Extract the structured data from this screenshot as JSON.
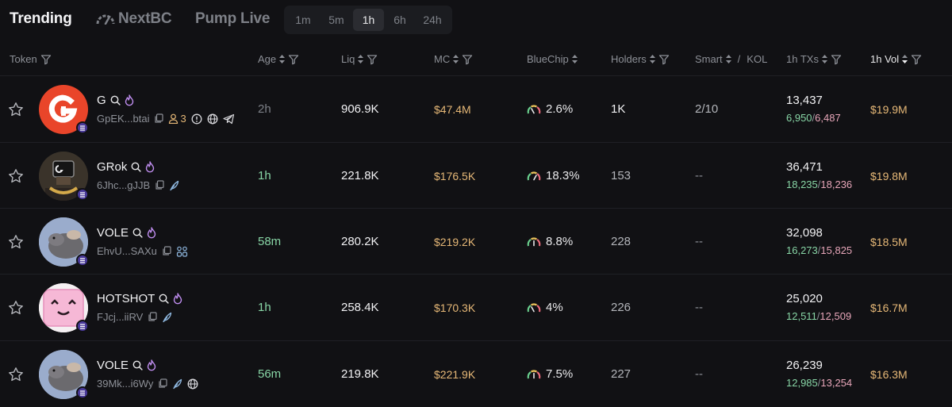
{
  "nav": {
    "tabs": [
      {
        "label": "Trending",
        "active": true
      },
      {
        "label": "NextBC",
        "active": false
      },
      {
        "label": "Pump Live",
        "active": false
      }
    ],
    "timeframes": [
      "1m",
      "5m",
      "1h",
      "6h",
      "24h"
    ],
    "active_timeframe": "1h"
  },
  "columns": {
    "token": "Token",
    "age": "Age",
    "liq": "Liq",
    "mc": "MC",
    "bluechip": "BlueChip",
    "holders": "Holders",
    "smart": "Smart",
    "smart_sep": "/",
    "kol": "KOL",
    "txs": "1h TXs",
    "vol": "1h Vol"
  },
  "rows": [
    {
      "name": "G",
      "address": "GpEK...btai",
      "holders_badge": "3",
      "age": "2h",
      "liq": "906.9K",
      "mc": "$47.4M",
      "bluechip": "2.6%",
      "holders": "1K",
      "smart_kol": "2/10",
      "txs": "13,437",
      "buys": "6,950",
      "sells": "6,487",
      "vol": "$19.9M"
    },
    {
      "name": "GRok",
      "address": "6Jhc...gJJB",
      "age": "1h",
      "liq": "221.8K",
      "mc": "$176.5K",
      "bluechip": "18.3%",
      "holders": "153",
      "smart_kol": "--",
      "txs": "36,471",
      "buys": "18,235",
      "sells": "18,236",
      "vol": "$19.8M"
    },
    {
      "name": "VOLE",
      "address": "EhvU...SAXu",
      "age": "58m",
      "liq": "280.2K",
      "mc": "$219.2K",
      "bluechip": "8.8%",
      "holders": "228",
      "smart_kol": "--",
      "txs": "32,098",
      "buys": "16,273",
      "sells": "15,825",
      "vol": "$18.5M"
    },
    {
      "name": "HOTSHOT",
      "address": "FJcj...iiRV",
      "age": "1h",
      "liq": "258.4K",
      "mc": "$170.3K",
      "bluechip": "4%",
      "holders": "226",
      "smart_kol": "--",
      "txs": "25,020",
      "buys": "12,511",
      "sells": "12,509",
      "vol": "$16.7M"
    },
    {
      "name": "VOLE",
      "address": "39Mk...i6Wy",
      "age": "56m",
      "liq": "219.8K",
      "mc": "$221.9K",
      "bluechip": "7.5%",
      "holders": "227",
      "smart_kol": "--",
      "txs": "26,239",
      "buys": "12,985",
      "sells": "13,254",
      "vol": "$16.3M"
    }
  ],
  "colors": {
    "buy": "#88d6a6",
    "sell": "#e7a6b9",
    "amount": "#e6b877",
    "g_logo": "#e9452a"
  }
}
